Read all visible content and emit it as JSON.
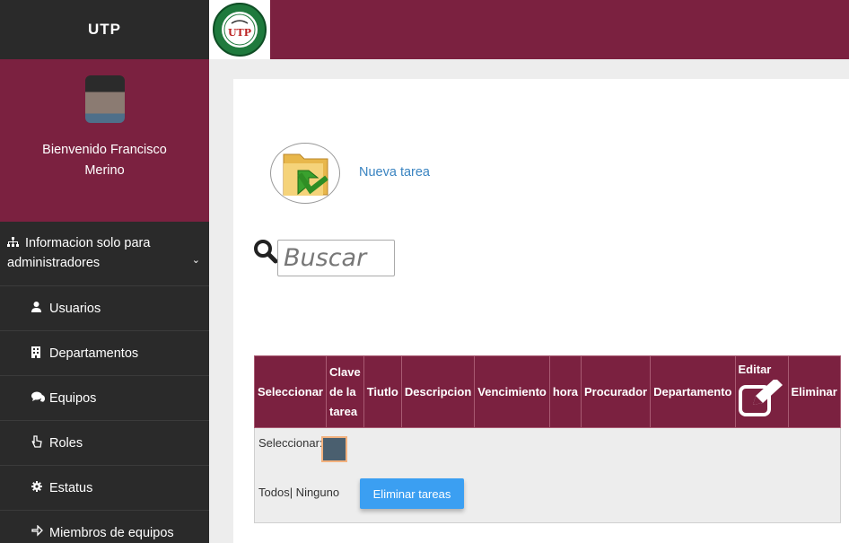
{
  "header": {
    "brand": "UTP"
  },
  "sidebar": {
    "welcome": "Bienvenido Francisco Merino",
    "section_title": "Informacion solo para administradores",
    "items": [
      {
        "label": "Usuarios",
        "icon": "user-icon"
      },
      {
        "label": "Departamentos",
        "icon": "building-icon"
      },
      {
        "label": "Equipos",
        "icon": "comments-icon"
      },
      {
        "label": "Roles",
        "icon": "hand-pointer-icon"
      },
      {
        "label": "Estatus",
        "icon": "gear-icon"
      },
      {
        "label": "Miembros de equipos",
        "icon": "hand-pointer-icon"
      }
    ]
  },
  "main": {
    "new_task_label": "Nueva tarea",
    "search_placeholder": "Buscar",
    "table": {
      "headers": [
        "Seleccionar",
        "Clave de la tarea",
        "Tiutlo",
        "Descripcion",
        "Vencimiento",
        "hora",
        "Procurador",
        "Departamento",
        "Editar",
        "Eliminar"
      ],
      "select_label": "Seleccionar:",
      "all_none": "Todos| Ninguno",
      "delete_button": "Eliminar tareas"
    }
  },
  "colors": {
    "accent": "#7b2140",
    "sidebar": "#2a2a2a",
    "link": "#3a84c1",
    "button": "#3b9ff2"
  }
}
